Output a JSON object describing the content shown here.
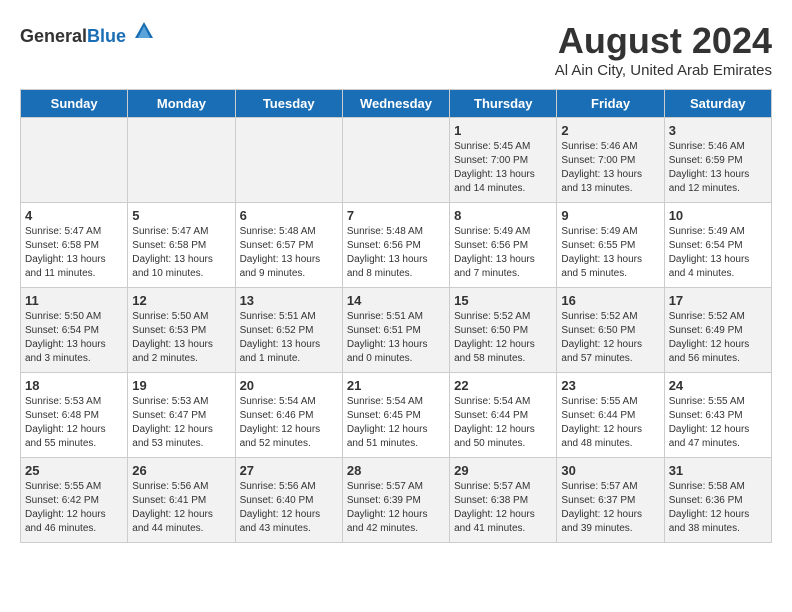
{
  "logo": {
    "general": "General",
    "blue": "Blue"
  },
  "title": "August 2024",
  "subtitle": "Al Ain City, United Arab Emirates",
  "days_of_week": [
    "Sunday",
    "Monday",
    "Tuesday",
    "Wednesday",
    "Thursday",
    "Friday",
    "Saturday"
  ],
  "weeks": [
    [
      {
        "day": "",
        "info": ""
      },
      {
        "day": "",
        "info": ""
      },
      {
        "day": "",
        "info": ""
      },
      {
        "day": "",
        "info": ""
      },
      {
        "day": "1",
        "info": "Sunrise: 5:45 AM\nSunset: 7:00 PM\nDaylight: 13 hours and 14 minutes."
      },
      {
        "day": "2",
        "info": "Sunrise: 5:46 AM\nSunset: 7:00 PM\nDaylight: 13 hours and 13 minutes."
      },
      {
        "day": "3",
        "info": "Sunrise: 5:46 AM\nSunset: 6:59 PM\nDaylight: 13 hours and 12 minutes."
      }
    ],
    [
      {
        "day": "4",
        "info": "Sunrise: 5:47 AM\nSunset: 6:58 PM\nDaylight: 13 hours and 11 minutes."
      },
      {
        "day": "5",
        "info": "Sunrise: 5:47 AM\nSunset: 6:58 PM\nDaylight: 13 hours and 10 minutes."
      },
      {
        "day": "6",
        "info": "Sunrise: 5:48 AM\nSunset: 6:57 PM\nDaylight: 13 hours and 9 minutes."
      },
      {
        "day": "7",
        "info": "Sunrise: 5:48 AM\nSunset: 6:56 PM\nDaylight: 13 hours and 8 minutes."
      },
      {
        "day": "8",
        "info": "Sunrise: 5:49 AM\nSunset: 6:56 PM\nDaylight: 13 hours and 7 minutes."
      },
      {
        "day": "9",
        "info": "Sunrise: 5:49 AM\nSunset: 6:55 PM\nDaylight: 13 hours and 5 minutes."
      },
      {
        "day": "10",
        "info": "Sunrise: 5:49 AM\nSunset: 6:54 PM\nDaylight: 13 hours and 4 minutes."
      }
    ],
    [
      {
        "day": "11",
        "info": "Sunrise: 5:50 AM\nSunset: 6:54 PM\nDaylight: 13 hours and 3 minutes."
      },
      {
        "day": "12",
        "info": "Sunrise: 5:50 AM\nSunset: 6:53 PM\nDaylight: 13 hours and 2 minutes."
      },
      {
        "day": "13",
        "info": "Sunrise: 5:51 AM\nSunset: 6:52 PM\nDaylight: 13 hours and 1 minute."
      },
      {
        "day": "14",
        "info": "Sunrise: 5:51 AM\nSunset: 6:51 PM\nDaylight: 13 hours and 0 minutes."
      },
      {
        "day": "15",
        "info": "Sunrise: 5:52 AM\nSunset: 6:50 PM\nDaylight: 12 hours and 58 minutes."
      },
      {
        "day": "16",
        "info": "Sunrise: 5:52 AM\nSunset: 6:50 PM\nDaylight: 12 hours and 57 minutes."
      },
      {
        "day": "17",
        "info": "Sunrise: 5:52 AM\nSunset: 6:49 PM\nDaylight: 12 hours and 56 minutes."
      }
    ],
    [
      {
        "day": "18",
        "info": "Sunrise: 5:53 AM\nSunset: 6:48 PM\nDaylight: 12 hours and 55 minutes."
      },
      {
        "day": "19",
        "info": "Sunrise: 5:53 AM\nSunset: 6:47 PM\nDaylight: 12 hours and 53 minutes."
      },
      {
        "day": "20",
        "info": "Sunrise: 5:54 AM\nSunset: 6:46 PM\nDaylight: 12 hours and 52 minutes."
      },
      {
        "day": "21",
        "info": "Sunrise: 5:54 AM\nSunset: 6:45 PM\nDaylight: 12 hours and 51 minutes."
      },
      {
        "day": "22",
        "info": "Sunrise: 5:54 AM\nSunset: 6:44 PM\nDaylight: 12 hours and 50 minutes."
      },
      {
        "day": "23",
        "info": "Sunrise: 5:55 AM\nSunset: 6:44 PM\nDaylight: 12 hours and 48 minutes."
      },
      {
        "day": "24",
        "info": "Sunrise: 5:55 AM\nSunset: 6:43 PM\nDaylight: 12 hours and 47 minutes."
      }
    ],
    [
      {
        "day": "25",
        "info": "Sunrise: 5:55 AM\nSunset: 6:42 PM\nDaylight: 12 hours and 46 minutes."
      },
      {
        "day": "26",
        "info": "Sunrise: 5:56 AM\nSunset: 6:41 PM\nDaylight: 12 hours and 44 minutes."
      },
      {
        "day": "27",
        "info": "Sunrise: 5:56 AM\nSunset: 6:40 PM\nDaylight: 12 hours and 43 minutes."
      },
      {
        "day": "28",
        "info": "Sunrise: 5:57 AM\nSunset: 6:39 PM\nDaylight: 12 hours and 42 minutes."
      },
      {
        "day": "29",
        "info": "Sunrise: 5:57 AM\nSunset: 6:38 PM\nDaylight: 12 hours and 41 minutes."
      },
      {
        "day": "30",
        "info": "Sunrise: 5:57 AM\nSunset: 6:37 PM\nDaylight: 12 hours and 39 minutes."
      },
      {
        "day": "31",
        "info": "Sunrise: 5:58 AM\nSunset: 6:36 PM\nDaylight: 12 hours and 38 minutes."
      }
    ]
  ]
}
